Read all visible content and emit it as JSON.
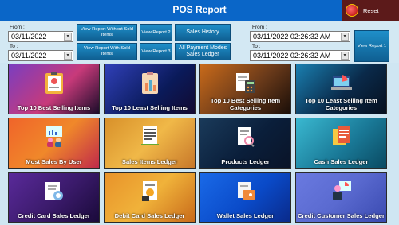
{
  "window": {
    "title": "POS Report",
    "reset_label": "Reset"
  },
  "filters": {
    "from_label": "From :",
    "to_label": "To :",
    "from_date": "03/11/2022",
    "to_date": "03/11/2022",
    "from_datetime": "03/11/2022 02:26:32 AM",
    "to_datetime": "03/11/2022 02:26:32 AM"
  },
  "buttons": {
    "without_sold": "View Report Without Sold Items",
    "with_sold": "View Report With Sold Items",
    "report2": "View Report 2",
    "report3": "View Report 3",
    "sales_history": "Sales History",
    "payment_modes": "All Payment Modes Sales Ledger",
    "report1": "View Report 1"
  },
  "tiles": [
    {
      "label": "Top 10 Best Selling Items",
      "icon": "clipboard-report-icon"
    },
    {
      "label": "Top 10 Least Selling Items",
      "icon": "clipboard-chart-icon"
    },
    {
      "label": "Top 10 Best Selling Item Categories",
      "icon": "document-calculator-icon"
    },
    {
      "label": "Top 10 Least Selling Item Categories",
      "icon": "laptop-chart-icon"
    },
    {
      "label": "Most Sales By User",
      "icon": "users-presentation-icon"
    },
    {
      "label": "Sales Items Ledger",
      "icon": "ledger-icon"
    },
    {
      "label": "Products Ledger",
      "icon": "document-search-icon"
    },
    {
      "label": "Cash Sales Ledger",
      "icon": "cash-document-icon"
    },
    {
      "label": "Credit Card Sales Ledger",
      "icon": "credit-card-report-icon"
    },
    {
      "label": "Debit Card Sales Ledger",
      "icon": "debit-card-report-icon"
    },
    {
      "label": "Wallet Sales Ledger",
      "icon": "wallet-icon"
    },
    {
      "label": "Credit Customer Sales Ledger",
      "icon": "customer-presentation-icon"
    }
  ],
  "colors": {
    "titlebar": "#0a66c8",
    "button": "#1a7fb8",
    "background": "#cfe6f2"
  }
}
